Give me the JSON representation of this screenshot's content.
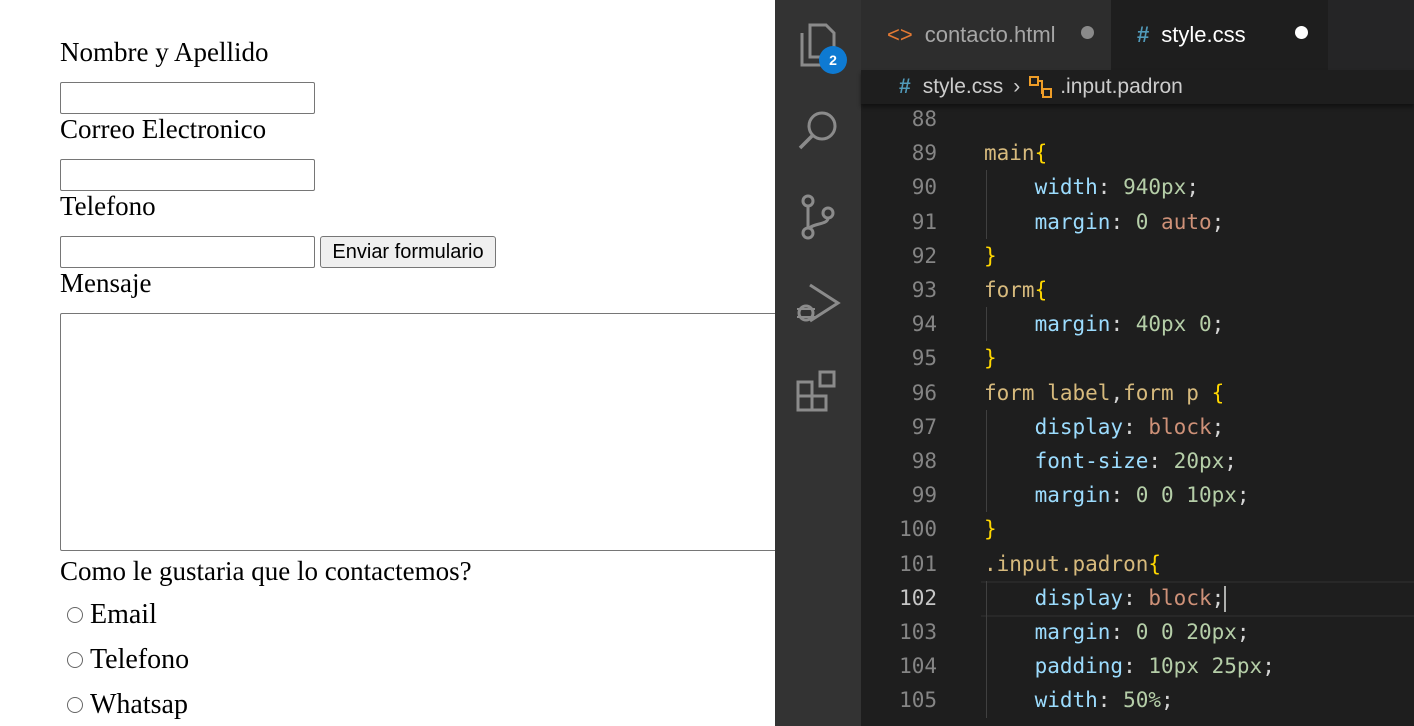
{
  "form": {
    "nombre_label": "Nombre y Apellido",
    "correo_label": "Correo Electronico",
    "telefono_label": "Telefono",
    "submit_label": "Enviar formulario",
    "mensaje_label": "Mensaje",
    "contact_question": "Como le gustaria que lo contactemos?",
    "options": [
      "Email",
      "Telefono",
      "Whatsap"
    ]
  },
  "editor": {
    "explorer_badge": "2",
    "tabs": [
      {
        "icon": "<>",
        "label": "contacto.html",
        "modified": true,
        "active": false
      },
      {
        "icon": "#",
        "label": "style.css",
        "modified": true,
        "active": true
      }
    ],
    "breadcrumb": {
      "file": "style.css",
      "symbol": ".input.padron"
    },
    "active_line": "102",
    "lines": [
      {
        "n": "88",
        "tokens": []
      },
      {
        "n": "89",
        "tokens": [
          {
            "t": "main",
            "c": "sel"
          },
          {
            "t": "{",
            "c": "brace"
          }
        ]
      },
      {
        "n": "90",
        "tokens": [
          {
            "t": "    ",
            "c": "punc"
          },
          {
            "t": "width",
            "c": "prop"
          },
          {
            "t": ": ",
            "c": "punc"
          },
          {
            "t": "940px",
            "c": "num"
          },
          {
            "t": ";",
            "c": "punc"
          }
        ]
      },
      {
        "n": "91",
        "tokens": [
          {
            "t": "    ",
            "c": "punc"
          },
          {
            "t": "margin",
            "c": "prop"
          },
          {
            "t": ": ",
            "c": "punc"
          },
          {
            "t": "0",
            "c": "num"
          },
          {
            "t": " ",
            "c": "punc"
          },
          {
            "t": "auto",
            "c": "kw"
          },
          {
            "t": ";",
            "c": "punc"
          }
        ]
      },
      {
        "n": "92",
        "tokens": [
          {
            "t": "}",
            "c": "brace"
          }
        ]
      },
      {
        "n": "93",
        "tokens": [
          {
            "t": "form",
            "c": "sel"
          },
          {
            "t": "{",
            "c": "brace"
          }
        ]
      },
      {
        "n": "94",
        "tokens": [
          {
            "t": "    ",
            "c": "punc"
          },
          {
            "t": "margin",
            "c": "prop"
          },
          {
            "t": ": ",
            "c": "punc"
          },
          {
            "t": "40px",
            "c": "num"
          },
          {
            "t": " ",
            "c": "punc"
          },
          {
            "t": "0",
            "c": "num"
          },
          {
            "t": ";",
            "c": "punc"
          }
        ]
      },
      {
        "n": "95",
        "tokens": [
          {
            "t": "}",
            "c": "brace"
          }
        ]
      },
      {
        "n": "96",
        "tokens": [
          {
            "t": "form label",
            "c": "sel"
          },
          {
            "t": ",",
            "c": "punc"
          },
          {
            "t": "form p",
            "c": "sel"
          },
          {
            "t": " ",
            "c": "punc"
          },
          {
            "t": "{",
            "c": "brace"
          }
        ]
      },
      {
        "n": "97",
        "tokens": [
          {
            "t": "    ",
            "c": "punc"
          },
          {
            "t": "display",
            "c": "prop"
          },
          {
            "t": ": ",
            "c": "punc"
          },
          {
            "t": "block",
            "c": "kw"
          },
          {
            "t": ";",
            "c": "punc"
          }
        ]
      },
      {
        "n": "98",
        "tokens": [
          {
            "t": "    ",
            "c": "punc"
          },
          {
            "t": "font-size",
            "c": "prop"
          },
          {
            "t": ": ",
            "c": "punc"
          },
          {
            "t": "20px",
            "c": "num"
          },
          {
            "t": ";",
            "c": "punc"
          }
        ]
      },
      {
        "n": "99",
        "tokens": [
          {
            "t": "    ",
            "c": "punc"
          },
          {
            "t": "margin",
            "c": "prop"
          },
          {
            "t": ": ",
            "c": "punc"
          },
          {
            "t": "0 0 10px",
            "c": "num"
          },
          {
            "t": ";",
            "c": "punc"
          }
        ]
      },
      {
        "n": "100",
        "tokens": [
          {
            "t": "}",
            "c": "brace"
          }
        ]
      },
      {
        "n": "101",
        "tokens": [
          {
            "t": ".input.padron",
            "c": "sel"
          },
          {
            "t": "{",
            "c": "brace"
          }
        ]
      },
      {
        "n": "102",
        "tokens": [
          {
            "t": "    ",
            "c": "punc"
          },
          {
            "t": "display",
            "c": "prop"
          },
          {
            "t": ": ",
            "c": "punc"
          },
          {
            "t": "block",
            "c": "kw"
          },
          {
            "t": ";",
            "c": "punc"
          }
        ]
      },
      {
        "n": "103",
        "tokens": [
          {
            "t": "    ",
            "c": "punc"
          },
          {
            "t": "margin",
            "c": "prop"
          },
          {
            "t": ": ",
            "c": "punc"
          },
          {
            "t": "0 0 20px",
            "c": "num"
          },
          {
            "t": ";",
            "c": "punc"
          }
        ]
      },
      {
        "n": "104",
        "tokens": [
          {
            "t": "    ",
            "c": "punc"
          },
          {
            "t": "padding",
            "c": "prop"
          },
          {
            "t": ": ",
            "c": "punc"
          },
          {
            "t": "10px 25px",
            "c": "num"
          },
          {
            "t": ";",
            "c": "punc"
          }
        ]
      },
      {
        "n": "105",
        "tokens": [
          {
            "t": "    ",
            "c": "punc"
          },
          {
            "t": "width",
            "c": "prop"
          },
          {
            "t": ": ",
            "c": "punc"
          },
          {
            "t": "50%",
            "c": "num"
          },
          {
            "t": ";",
            "c": "punc"
          }
        ]
      }
    ]
  }
}
